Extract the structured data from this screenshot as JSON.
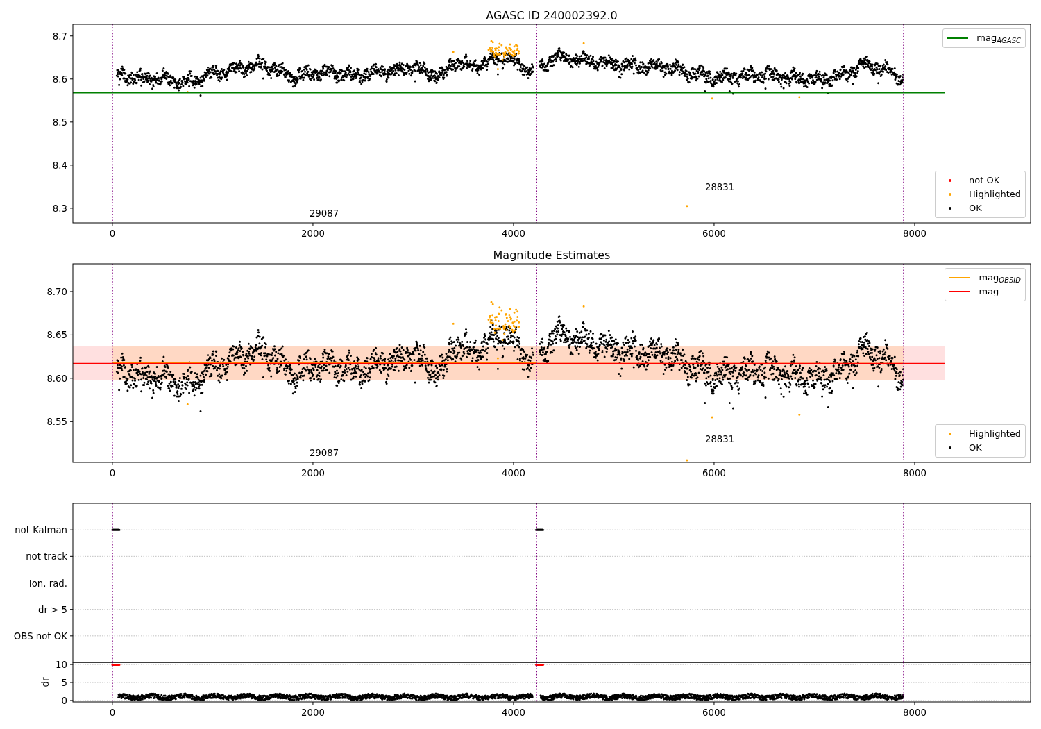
{
  "figure": {
    "panels": [
      {
        "kind": "magnitudes",
        "chart_data": {
          "type": "scatter",
          "title": "AGASC ID 240002392.0",
          "xlim": [
            -394,
            9156
          ],
          "ylim": [
            8.266,
            8.727
          ],
          "xticks": [
            {
              "value": 0,
              "label": "0"
            },
            {
              "value": 2000,
              "label": "2000"
            },
            {
              "value": 4000,
              "label": "4000"
            },
            {
              "value": 6000,
              "label": "6000"
            },
            {
              "value": 8000,
              "label": "8000"
            }
          ],
          "yticks": [
            {
              "value": 8.3,
              "label": "8.3"
            },
            {
              "value": 8.4,
              "label": "8.4"
            },
            {
              "value": 8.5,
              "label": "8.5"
            },
            {
              "value": 8.6,
              "label": "8.6"
            },
            {
              "value": 8.7,
              "label": "8.7"
            }
          ],
          "series": [
            {
              "name": "mag$_{AGASC}$",
              "type": "line",
              "color": "#008000",
              "x": [
                -394,
                8300
              ],
              "values": [
                8.568,
                8.568
              ]
            }
          ],
          "ref_lines": [
            {
              "axis": "x",
              "value": 0
            },
            {
              "axis": "x",
              "value": 4230
            },
            {
              "axis": "x",
              "value": 7890
            }
          ],
          "annotations": [
            "29087",
            "28831"
          ],
          "legend": "upper right"
        },
        "point_legend": [
          {
            "label": "not OK",
            "color": "#ff0000"
          },
          {
            "label": "Highlighted",
            "color": "#ffa500"
          },
          {
            "label": "OK",
            "color": "#000000"
          }
        ]
      },
      {
        "kind": "magnitudes",
        "chart_data": {
          "type": "scatter",
          "title": "Magnitude Estimates",
          "xlim": [
            -394,
            9156
          ],
          "ylim": [
            8.503,
            8.732
          ],
          "xticks": [
            {
              "value": 0,
              "label": "0"
            },
            {
              "value": 2000,
              "label": "2000"
            },
            {
              "value": 4000,
              "label": "4000"
            },
            {
              "value": 6000,
              "label": "6000"
            },
            {
              "value": 8000,
              "label": "8000"
            }
          ],
          "yticks": [
            {
              "value": 8.55,
              "label": "8.55"
            },
            {
              "value": 8.6,
              "label": "8.60"
            },
            {
              "value": 8.65,
              "label": "8.65"
            },
            {
              "value": 8.7,
              "label": "8.70"
            }
          ],
          "series": [
            {
              "name": "mag$_{OBSID}$",
              "type": "line",
              "color": "#ffa500",
              "x": [
                0,
                4225,
                4235,
                7890
              ],
              "values": [
                8.618,
                8.618,
                8.617,
                8.617
              ]
            },
            {
              "name": "mag",
              "type": "line",
              "color": "#ff0000",
              "x": [
                -394,
                8300
              ],
              "values": [
                8.617,
                8.617
              ]
            }
          ],
          "bands": [
            {
              "axis": "y",
              "from": 8.598,
              "to": 8.637,
              "color": "#ff0000"
            },
            {
              "axis": "y",
              "from": 8.598,
              "to": 8.637,
              "color": "#ffa500"
            }
          ],
          "ref_lines": [
            {
              "axis": "x",
              "value": 0
            },
            {
              "axis": "x",
              "value": 4230
            },
            {
              "axis": "x",
              "value": 7890
            }
          ],
          "annotations": [
            "29087",
            "28831"
          ],
          "legend": "upper right"
        },
        "point_legend": [
          {
            "label": "Highlighted",
            "color": "#ffa500"
          },
          {
            "label": "OK",
            "color": "#000000"
          }
        ]
      },
      {
        "kind": "flags",
        "chart_data": {
          "type": "other",
          "categories": [
            "OBS not OK",
            "dr > 5",
            "Ion. rad.",
            "not track",
            "not Kalman"
          ]
        }
      },
      {
        "kind": "dr",
        "chart_data": {
          "type": "scatter",
          "ylabel": "dr",
          "xlim": [
            -394,
            9156
          ],
          "ylim": [
            -0.4,
            10.6
          ],
          "xticks": [
            {
              "value": 0,
              "label": "0"
            },
            {
              "value": 2000,
              "label": "2000"
            },
            {
              "value": 4000,
              "label": "4000"
            },
            {
              "value": 6000,
              "label": "6000"
            },
            {
              "value": 8000,
              "label": "8000"
            }
          ],
          "yticks": [
            {
              "value": 0,
              "label": "0"
            },
            {
              "value": 5,
              "label": "5"
            },
            {
              "value": 10,
              "label": "10"
            }
          ],
          "ref_lines": [
            {
              "axis": "x",
              "value": 0
            },
            {
              "axis": "x",
              "value": 4230
            },
            {
              "axis": "x",
              "value": 7890
            }
          ]
        }
      }
    ]
  }
}
